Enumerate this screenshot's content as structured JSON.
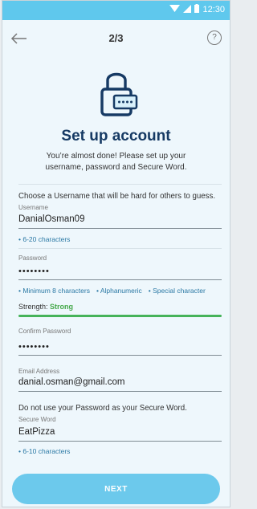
{
  "status_bar": {
    "time": "12:30",
    "icons": [
      "wifi-icon",
      "signal-icon",
      "battery-icon"
    ]
  },
  "header": {
    "step": "2/3",
    "help_symbol": "?"
  },
  "hero": {
    "title": "Set up account",
    "subtitle": "You’re almost done! Please set up your username, password and Secure Word."
  },
  "form": {
    "username_hint": "Choose a Username that will be hard for others to guess.",
    "username_label": "Username",
    "username_value": "DanialOsman09",
    "username_rule": "• 6-20 characters",
    "password_label": "Password",
    "password_value": "••••••••",
    "password_rules": [
      "• Minimum 8 characters",
      "• Alphanumeric",
      "• Special character"
    ],
    "strength_label": "Strength:",
    "strength_value": "Strong",
    "strength_level": 1,
    "confirm_label": "Confirm Password",
    "confirm_value": "••••••••",
    "email_label": "Email Address",
    "email_value": "danial.osman@gmail.com",
    "secure_hint": "Do not use your Password as your Secure Word.",
    "secure_label": "Secure Word",
    "secure_value": "EatPizza",
    "secure_rule": "• 6-10 characters"
  },
  "actions": {
    "next_label": "NEXT"
  },
  "colors": {
    "status_bar": "#5fc8ed",
    "title": "#163a64",
    "rule_text": "#2a78a4",
    "strength": "#46b35a",
    "button": "#6cc9ec"
  }
}
